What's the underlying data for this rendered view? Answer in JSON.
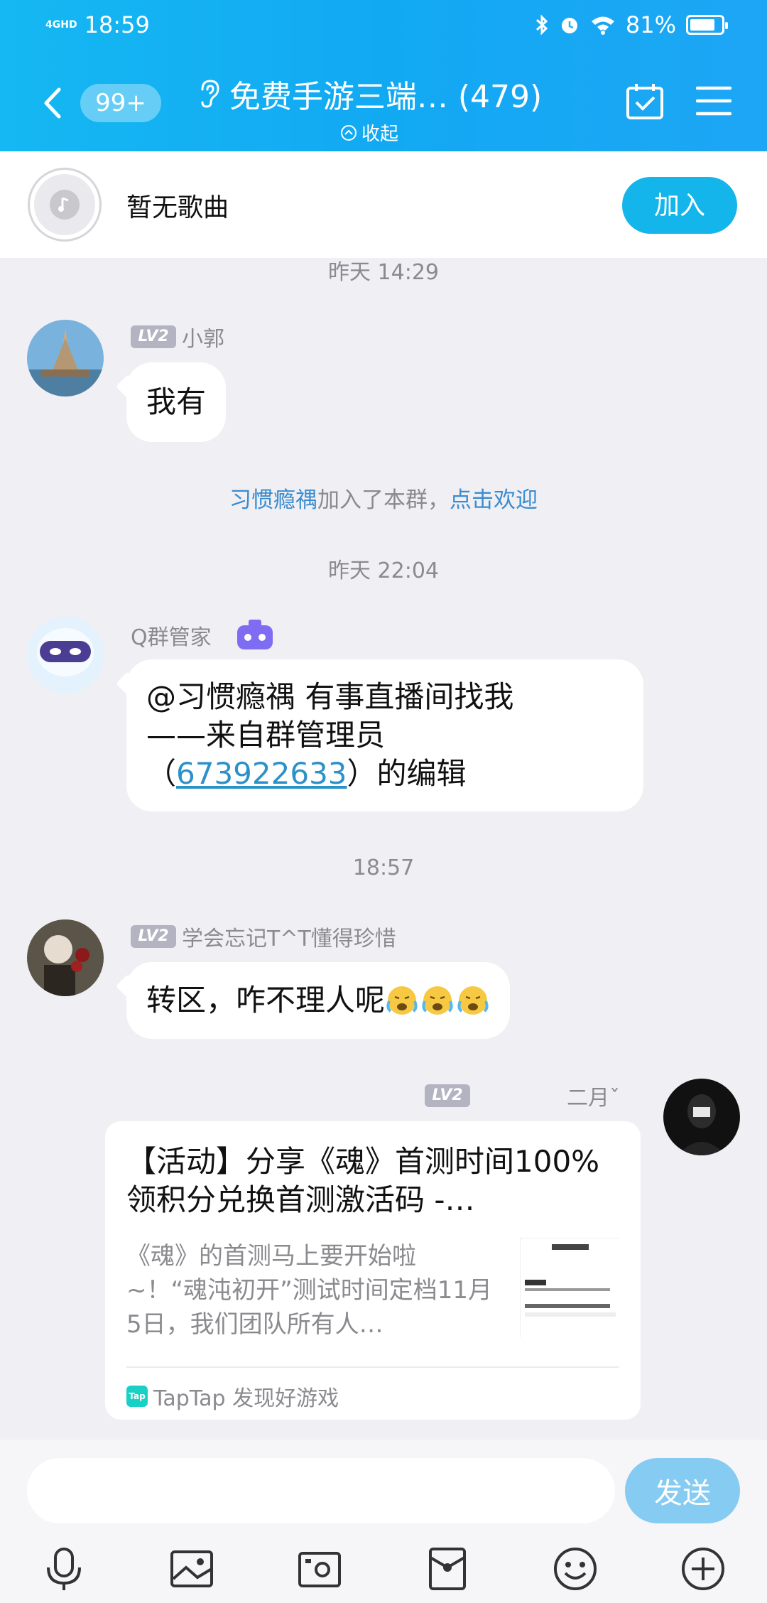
{
  "status_bar": {
    "network": "4GHD",
    "time": "18:59",
    "battery": "81%",
    "battery_level": 0.81
  },
  "nav": {
    "unread_badge": "99+",
    "title": "免费手游三端… (479)",
    "collapse": "收起"
  },
  "music": {
    "label": "暂无歌曲",
    "join": "加入"
  },
  "chat": {
    "ts1": "昨天 14:29",
    "msg1": {
      "level": "LV2",
      "name": "小郭",
      "text": "我有"
    },
    "sys": {
      "user": "习惯瘾禑",
      "mid": "加入了本群，",
      "action": "点击欢迎"
    },
    "ts2": "昨天 22:04",
    "msg2": {
      "name": "Q群管家",
      "line1": "@习惯瘾禑 有事直播间找我",
      "line2": "——来自群管理员",
      "line3_pre": "（",
      "line3_link": "673922633",
      "line3_post": "）的编辑"
    },
    "ts3": "18:57",
    "msg3": {
      "level": "LV2",
      "name": "学会忘记T^T懂得珍惜",
      "text": "转区，咋不理人呢"
    },
    "msg4": {
      "level": "LV2",
      "name": "二月ˇ",
      "card_title": "【活动】分享《魂》首测时间100%领积分兑换首测激活码 -…",
      "card_desc": "《魂》的首测马上要开始啦~！“魂沌初开”测试时间定档11月5日，我们团队所有人…",
      "card_source": "TapTap 发现好游戏",
      "logo_text": "Tap"
    }
  },
  "input": {
    "send": "发送"
  }
}
